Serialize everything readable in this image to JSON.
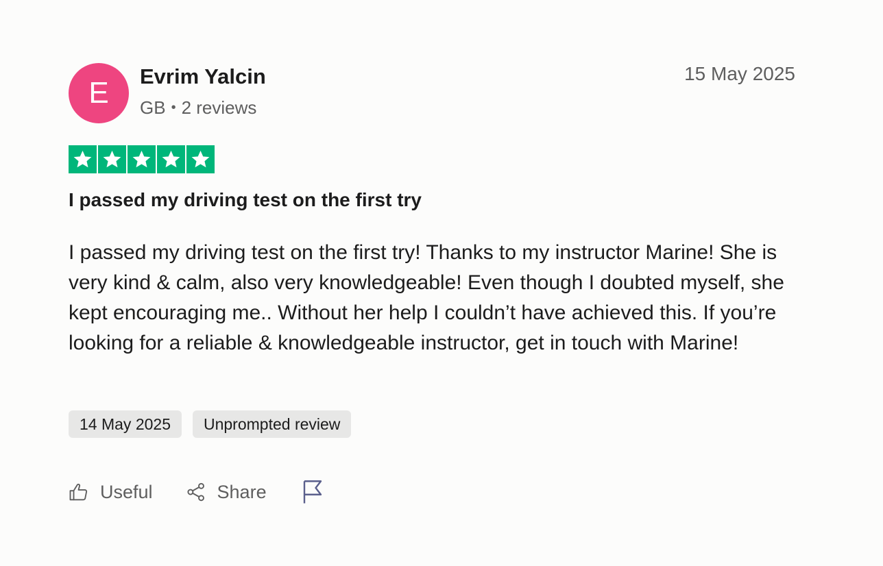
{
  "reviewer": {
    "initial": "E",
    "name": "Evrim Yalcin",
    "country": "GB",
    "reviews": "2 reviews",
    "avatar_color": "#ee4580"
  },
  "review": {
    "date": "15 May 2025",
    "rating": 5,
    "rating_max": 5,
    "star_color": "#00b67a",
    "title": "I passed my driving test on the first try",
    "body": "I passed my driving test on the first try! Thanks to my instructor Marine! She is very kind & calm, also very knowledgeable! Even though I doubted myself, she kept encouraging me.. Without her help I couldn’t have achieved this. If you’re looking for a reliable & knowledgeable instructor, get in touch with Marine!",
    "tags": [
      "14 May 2025",
      "Unprompted review"
    ]
  },
  "actions": {
    "useful_label": "Useful",
    "share_label": "Share",
    "useful_icon": "thumbs-up-icon",
    "share_icon": "share-icon",
    "report_icon": "flag-icon"
  }
}
